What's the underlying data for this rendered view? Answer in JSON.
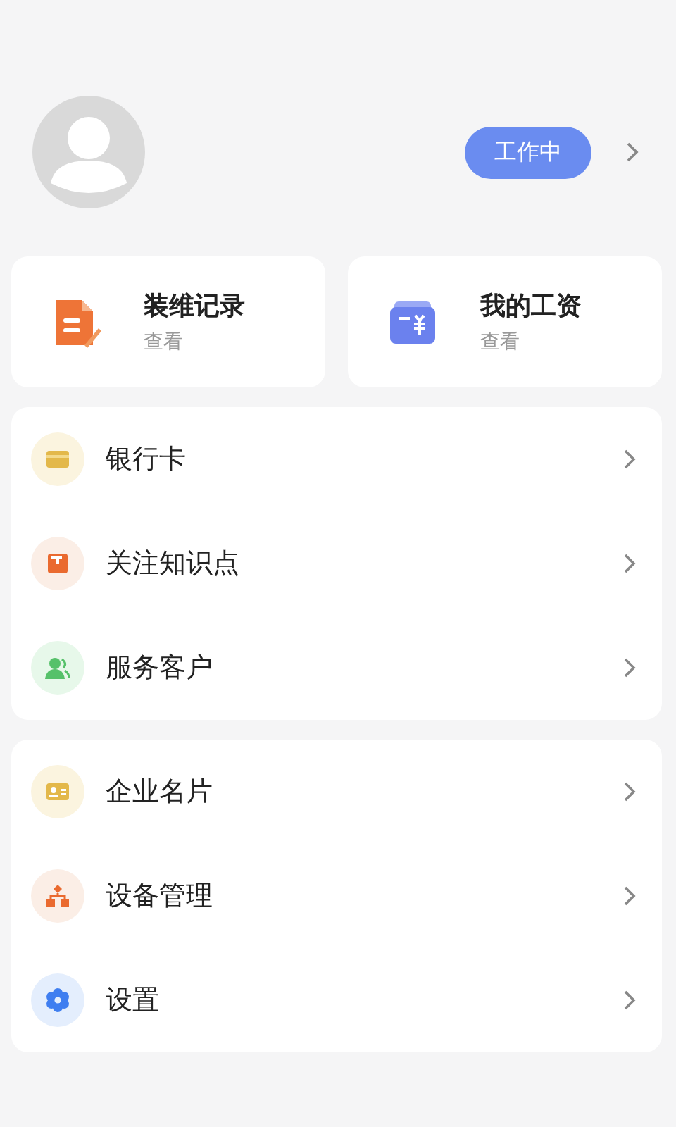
{
  "profile": {
    "status": "工作中"
  },
  "shortcuts": [
    {
      "title": "装维记录",
      "subtitle": "查看"
    },
    {
      "title": "我的工资",
      "subtitle": "查看"
    }
  ],
  "menu_groups": [
    [
      {
        "label": "银行卡"
      },
      {
        "label": "关注知识点"
      },
      {
        "label": "服务客户"
      }
    ],
    [
      {
        "label": "企业名片"
      },
      {
        "label": "设备管理"
      },
      {
        "label": "设置"
      }
    ]
  ]
}
